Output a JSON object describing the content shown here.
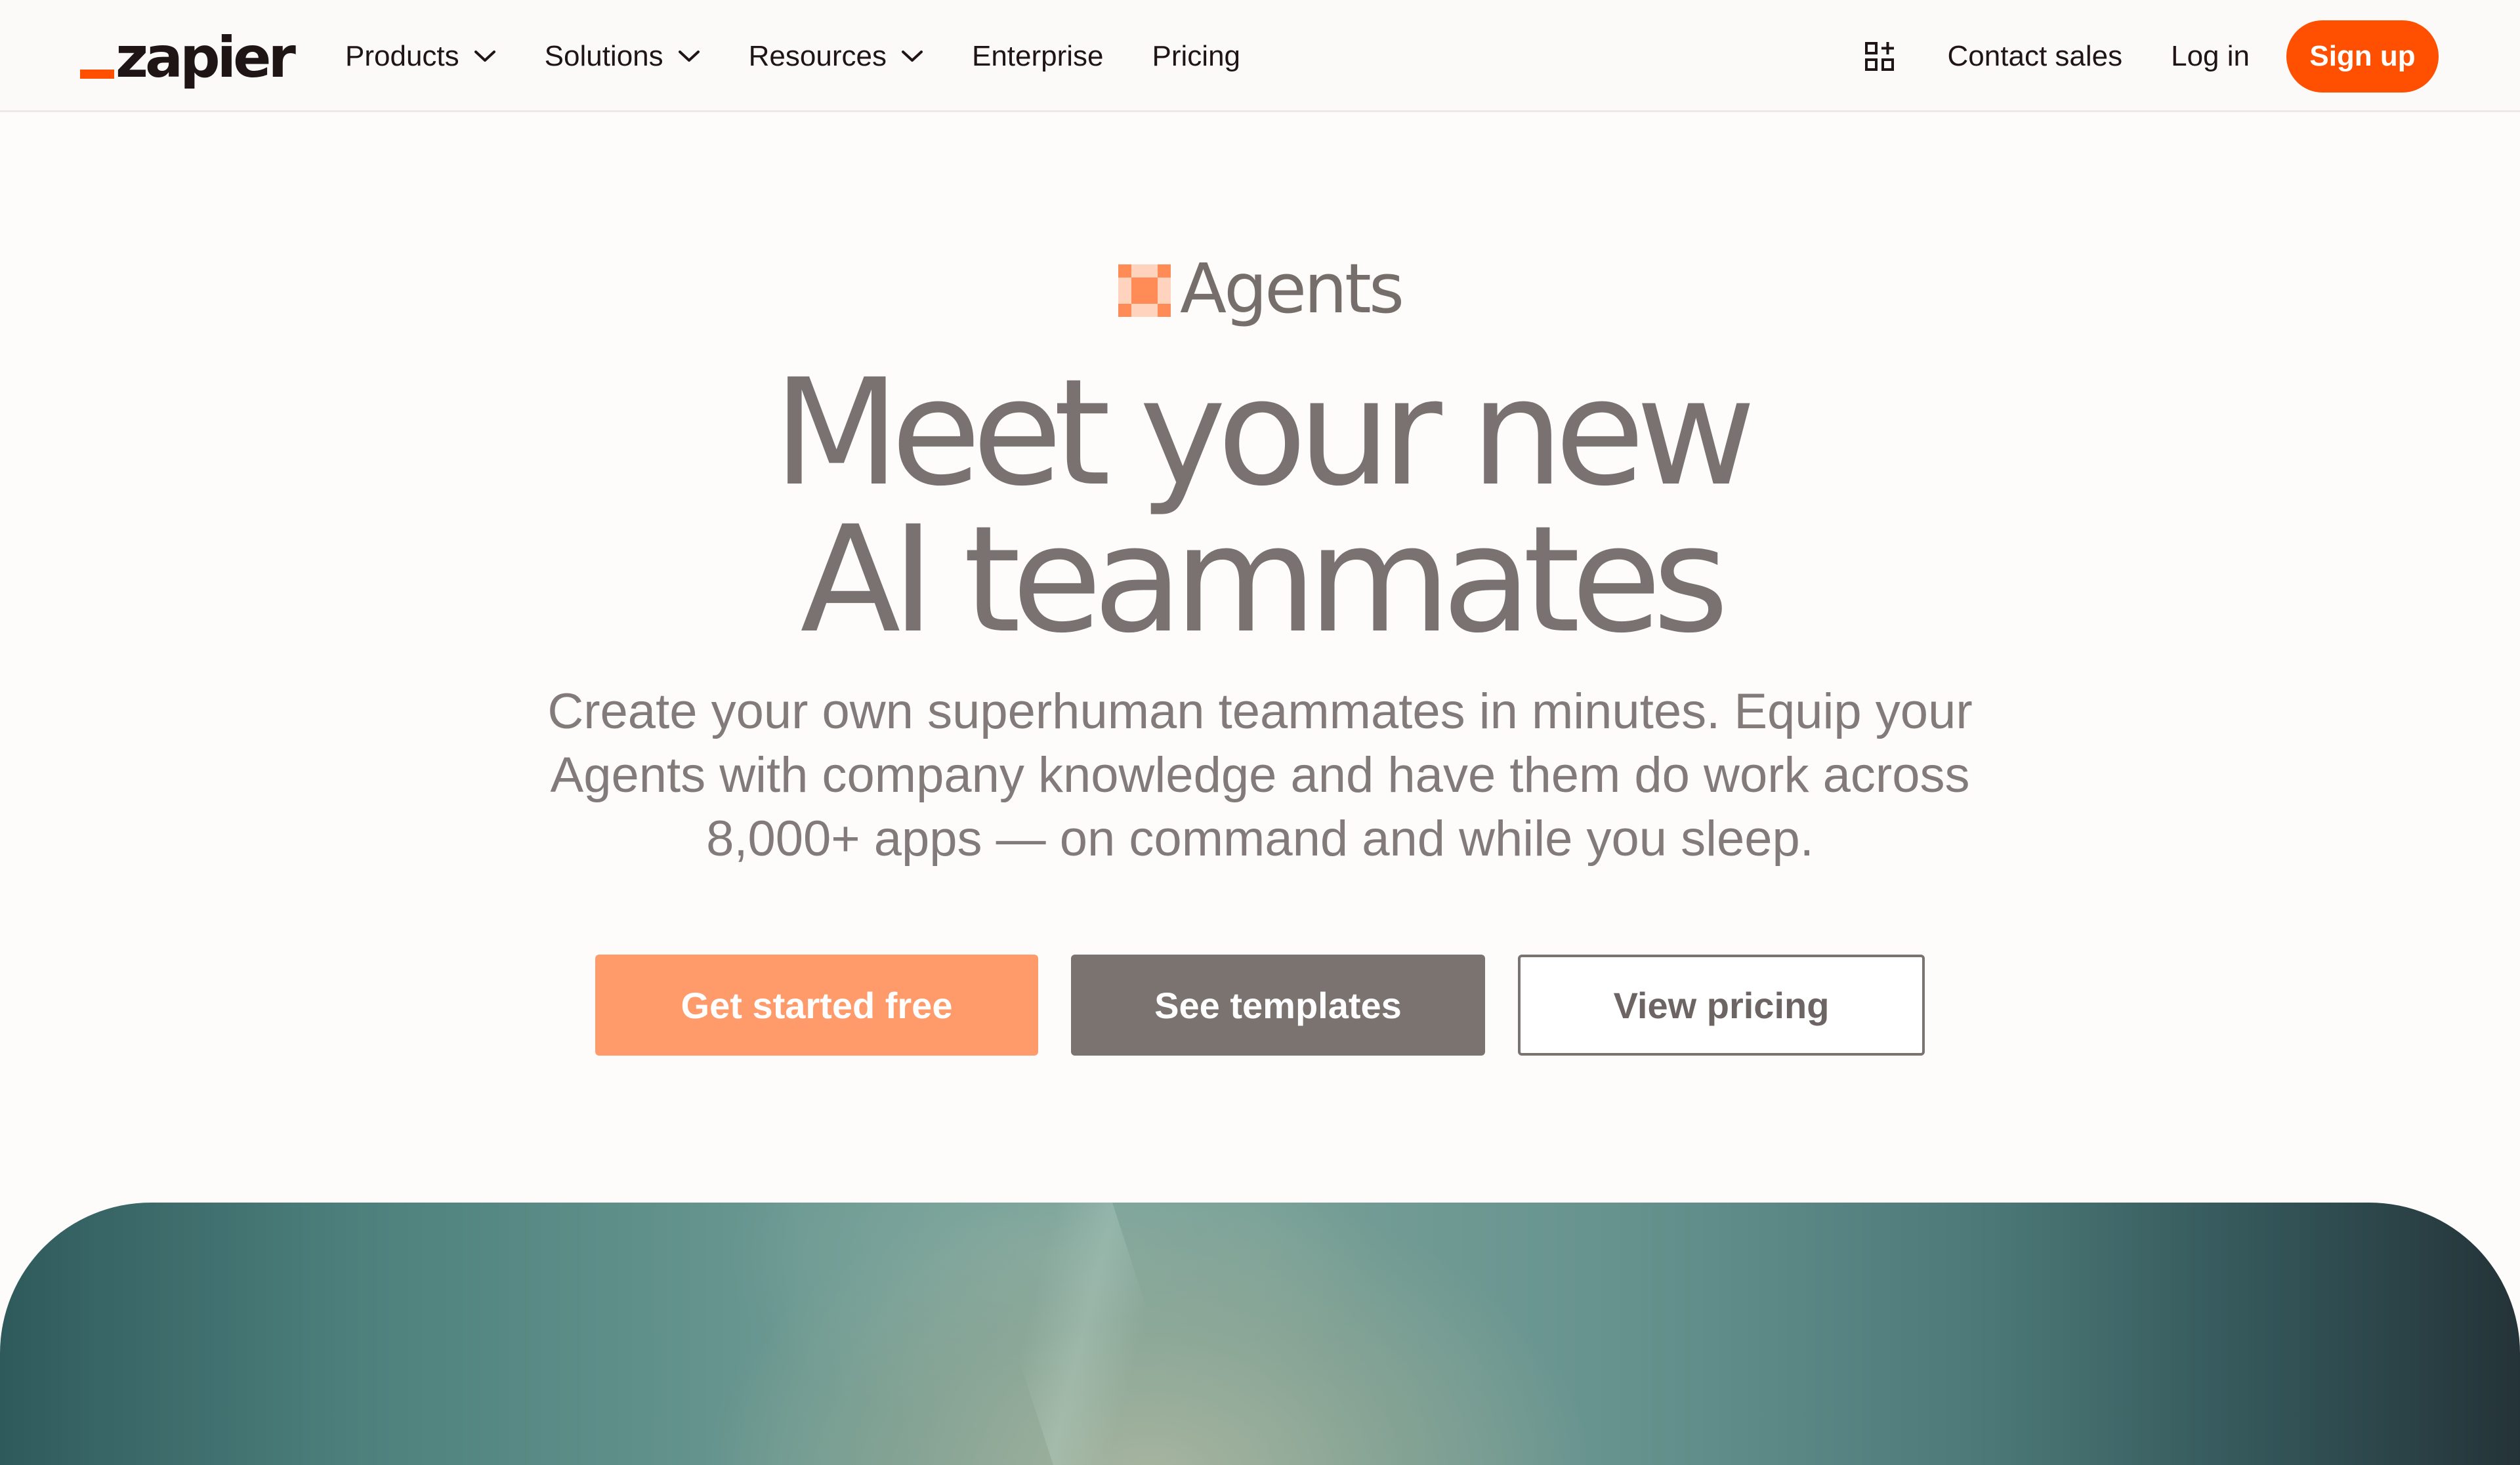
{
  "brand": {
    "logo_text": "zapier",
    "accent_color": "#ff4f00"
  },
  "nav": {
    "products_label": "Products",
    "solutions_label": "Solutions",
    "resources_label": "Resources",
    "enterprise_label": "Enterprise",
    "pricing_label": "Pricing",
    "apps_icon": "apps-grid-icon",
    "contact_sales_label": "Contact sales",
    "login_label": "Log in",
    "signup_label": "Sign up"
  },
  "hero": {
    "product_label": "Agents",
    "product_icon": "agents-icon",
    "headline_line1": "Meet your new",
    "headline_line2": "AI teammates",
    "subtitle": "Create your own superhuman teammates in minutes. Equip your Agents with company knowledge and have them do work across 8,000+ apps — on command and while you sleep.",
    "cta_primary": "Get started free",
    "cta_secondary": "See templates",
    "cta_outline": "View pricing"
  },
  "colors": {
    "primary_button": "#ff9b6b",
    "secondary_button": "#7a7370",
    "headline_text": "#7a7271"
  }
}
